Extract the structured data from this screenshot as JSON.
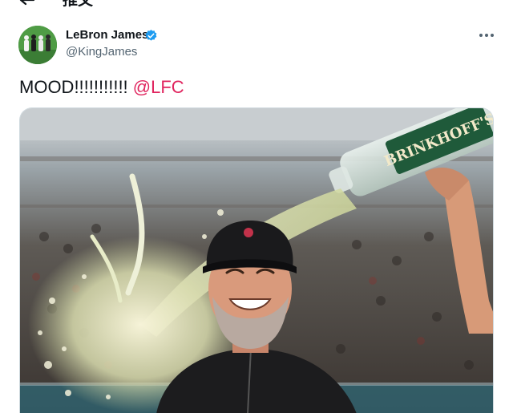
{
  "header": {
    "back_icon": "arrow-left-icon",
    "title": "推文"
  },
  "tweet": {
    "author": {
      "name": "LeBron James",
      "handle": "@KingJames",
      "verified": true,
      "verified_color": "#1d9bf0"
    },
    "more_icon": "more-horizontal-icon",
    "text": "MOOD!!!!!!!!!!! ",
    "mention": "@LFC",
    "mention_color": "#e0245e",
    "media": {
      "bottle_label": "BRINKHOFF'S"
    }
  }
}
